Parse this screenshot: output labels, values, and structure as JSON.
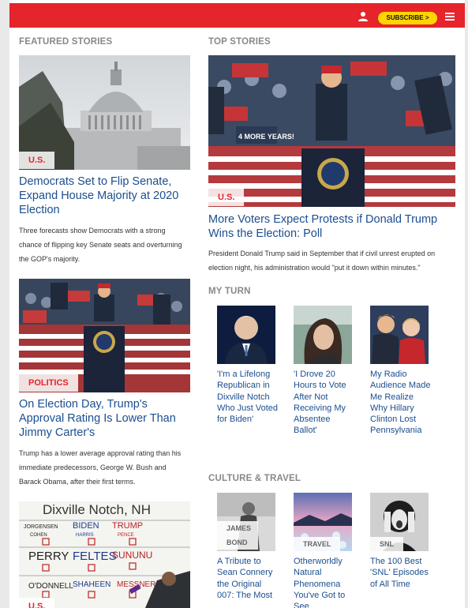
{
  "header": {
    "subscribe_label": "SUBSCRIBE >",
    "brand_color": "#e5242b",
    "accent_color": "#ffd400",
    "icons": [
      "user-icon",
      "menu-icon"
    ]
  },
  "featured": {
    "title": "FEATURED STORIES",
    "items": [
      {
        "tag": "U.S.",
        "headline": "Democrats Set to Flip Senate, Expand House Majority at 2020 Election",
        "blurb": "Three forecasts show Democrats with a strong chance of flipping key Senate seats and overturning the GOP's majority."
      },
      {
        "tag": "POLITICS",
        "headline": "On Election Day, Trump's Approval Rating Is Lower Than Jimmy Carter's",
        "blurb": "Trump has a lower average approval rating than his immediate predecessors, George W. Bush and Barack Obama, after their first terms."
      },
      {
        "tag": "U.S.",
        "board_lines": [
          "Dixville Notch, NH",
          "JORGENSEN",
          "BIDEN",
          "TRUMP",
          "COHEN",
          "HARRIS",
          "PENCE",
          "PERRY",
          "FELTES",
          "SUNUNU",
          "O'DONNELL",
          "SHAHEEN",
          "MESSNER"
        ]
      }
    ]
  },
  "top": {
    "title": "TOP STORIES",
    "tag": "U.S.",
    "headline": "More Voters Expect Protests if Donald Trump Wins the Election: Poll",
    "blurb": "President Donald Trump said in September that if civil unrest erupted on election night, his administration would \"put it down within minutes.\"",
    "sign_text": "4 MORE YEARS!"
  },
  "my_turn": {
    "title": "MY TURN",
    "items": [
      {
        "title": "'I'm a Lifelong Republican in Dixville Notch Who Just Voted for Biden'"
      },
      {
        "title": "'I Drove 20 Hours to Vote After Not Receiving My Absentee Ballot'"
      },
      {
        "title": "My Radio Audience Made Me Realize Why Hillary Clinton Lost Pennsylvania"
      }
    ]
  },
  "culture": {
    "title": "CULTURE & TRAVEL",
    "items": [
      {
        "tag": "JAMES BOND",
        "title": "A Tribute to Sean Connery the Original 007: The Most"
      },
      {
        "tag": "TRAVEL",
        "title": "Otherworldly Natural Phenomena You've Got to See"
      },
      {
        "tag": "SNL",
        "title": "The 100 Best 'SNL' Episodes of All Time"
      }
    ]
  }
}
